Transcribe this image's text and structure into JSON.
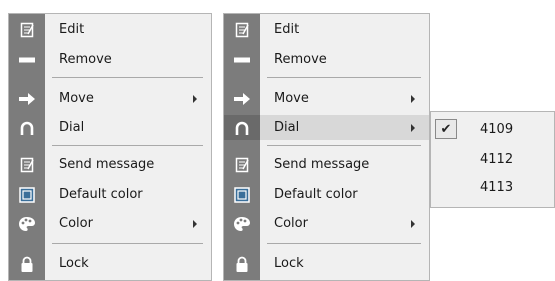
{
  "menu_left": {
    "items": [
      {
        "label": "Edit",
        "icon": "edit-icon"
      },
      {
        "label": "Remove",
        "icon": "remove-icon"
      },
      {
        "label": "Move",
        "icon": "move-icon",
        "submenu": true
      },
      {
        "label": "Dial",
        "icon": "dial-icon"
      },
      {
        "label": "Send message",
        "icon": "send-message-icon"
      },
      {
        "label": "Default color",
        "icon": "default-color-icon"
      },
      {
        "label": "Color",
        "icon": "color-icon",
        "submenu": true
      },
      {
        "label": "Lock",
        "icon": "lock-icon"
      }
    ]
  },
  "menu_right": {
    "items": [
      {
        "label": "Edit",
        "icon": "edit-icon"
      },
      {
        "label": "Remove",
        "icon": "remove-icon"
      },
      {
        "label": "Move",
        "icon": "move-icon",
        "submenu": true
      },
      {
        "label": "Dial",
        "icon": "dial-icon",
        "submenu": true,
        "highlighted": true
      },
      {
        "label": "Send message",
        "icon": "send-message-icon"
      },
      {
        "label": "Default color",
        "icon": "default-color-icon"
      },
      {
        "label": "Color",
        "icon": "color-icon",
        "submenu": true
      },
      {
        "label": "Lock",
        "icon": "lock-icon"
      }
    ]
  },
  "dial_submenu": {
    "items": [
      {
        "label": "4109",
        "checked": true
      },
      {
        "label": "4112",
        "checked": false
      },
      {
        "label": "4113",
        "checked": false
      }
    ],
    "check_glyph": "✔"
  },
  "colors": {
    "gutter": "#7c7c7c",
    "menu_bg": "#f0f0f0",
    "highlight": "#d8d8d8"
  }
}
